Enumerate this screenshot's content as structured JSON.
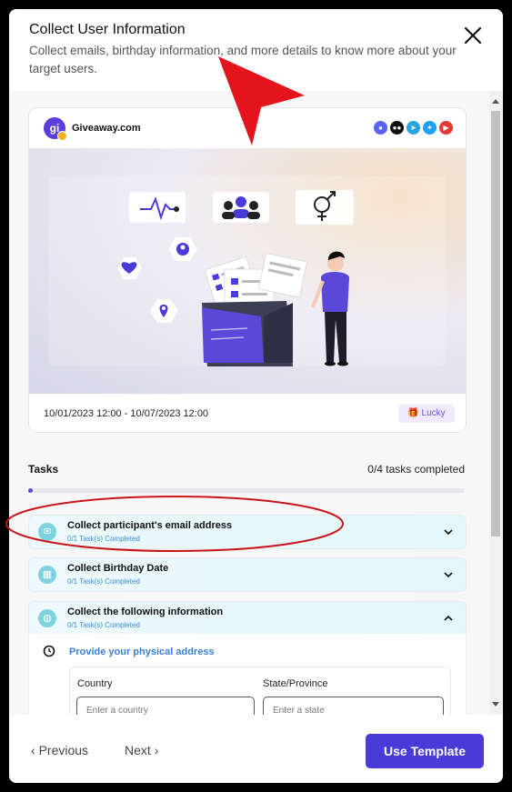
{
  "modal": {
    "title": "Collect User Information",
    "subtitle": "Collect emails, birthday information, and more details to know more about your target users."
  },
  "card": {
    "brand_initials": "gi",
    "brand_name": "Giveaway.com",
    "social_icons": [
      "discord-icon",
      "medium-icon",
      "telegram-icon",
      "twitter-icon",
      "youtube-icon"
    ],
    "date_range": "10/01/2023 12:00 - 10/07/2023 12:00",
    "badge_label": "Lucky"
  },
  "tasks": {
    "label": "Tasks",
    "count": "0/4 tasks completed",
    "progress": 0.0,
    "items": [
      {
        "name": "Collect participant's email address",
        "status": "0/1 Task(s) Completed",
        "icon": "mail-icon",
        "expanded": false
      },
      {
        "name": "Collect Birthday Date",
        "status": "0/1 Task(s) Completed",
        "icon": "cake-icon",
        "expanded": false
      },
      {
        "name": "Collect the following information",
        "status": "0/1 Task(s) Completed",
        "icon": "globe-icon",
        "expanded": true
      }
    ],
    "subtask": {
      "title": "Provide your physical address",
      "country_label": "Country",
      "country_placeholder": "Enter a country",
      "state_label": "State/Province",
      "state_placeholder": "Enter a state"
    }
  },
  "footer": {
    "previous": "Previous",
    "next": "Next",
    "use_template": "Use Template"
  },
  "colors": {
    "accent": "#4a3bd9",
    "annotation_arrow": "#e3141b",
    "annotation_circle": "#c8141a"
  }
}
